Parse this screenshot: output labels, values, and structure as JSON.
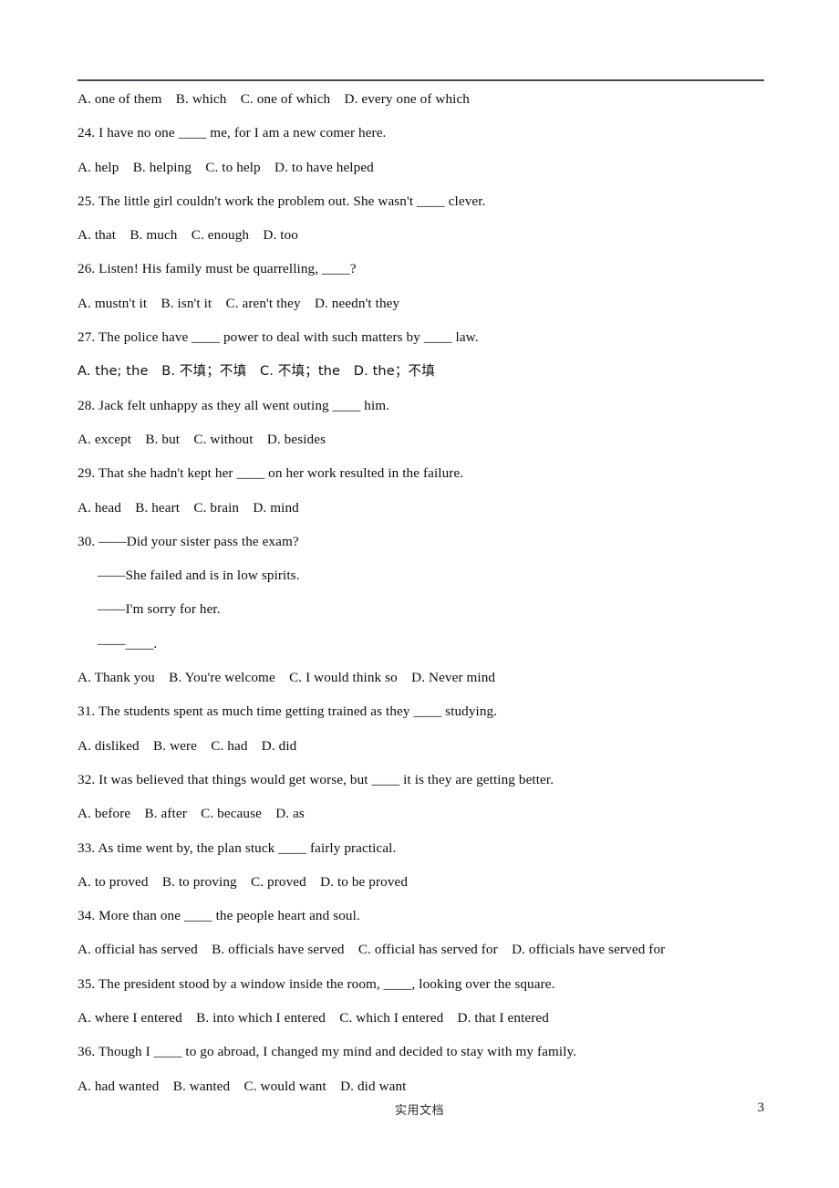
{
  "page": {
    "page_number": "3",
    "footer_label": "实用文档",
    "top_rule": true
  },
  "lines": [
    {
      "id": "q23-options",
      "type": "options",
      "text": "A. one of them B. which C. one of which D. every one of which"
    },
    {
      "id": "q24-stem",
      "type": "question",
      "text": "24. I have no one ____ me, for I am a new comer here."
    },
    {
      "id": "q24-options",
      "type": "options",
      "text": "A. help B. helping C. to help D. to have helped"
    },
    {
      "id": "q25-stem",
      "type": "question",
      "text": "25. The little girl couldn't work the problem out. She wasn't ____ clever."
    },
    {
      "id": "q25-options",
      "type": "options",
      "text": "A. that B. much C. enough D. too"
    },
    {
      "id": "q26-stem",
      "type": "question",
      "text": "26. Listen! His family must be quarrelling, ____?"
    },
    {
      "id": "q26-options",
      "type": "options",
      "text": "A. mustn't it B. isn't it C. aren't they D. needn't they"
    },
    {
      "id": "q27-stem",
      "type": "question",
      "text": "27. The police have ____ power to deal with such matters by ____ law."
    },
    {
      "id": "q27-options",
      "type": "options",
      "text": "A. the; the B. 不填；不填 C. 不填；the D. the；不填"
    },
    {
      "id": "q28-stem",
      "type": "question",
      "text": "28. Jack felt unhappy as they all went outing ____ him."
    },
    {
      "id": "q28-options",
      "type": "options",
      "text": "A. except B. but C. without D. besides"
    },
    {
      "id": "q29-stem",
      "type": "question",
      "text": "29. That she hadn't kept her ____ on her work resulted in the failure."
    },
    {
      "id": "q29-options",
      "type": "options",
      "text": "A. head B. heart C. brain D. mind"
    },
    {
      "id": "q30-stem",
      "type": "question",
      "text": "30. ——Did your sister pass the exam?"
    },
    {
      "id": "q30-reply-1",
      "type": "dialogue",
      "text": "——She failed and is in low spirits."
    },
    {
      "id": "q30-reply-2",
      "type": "dialogue",
      "text": "——I'm sorry for her."
    },
    {
      "id": "q30-reply-3",
      "type": "dialogue",
      "text": "——____."
    },
    {
      "id": "q30-options",
      "type": "options",
      "text": "A. Thank you B. You're welcome C. I would think so D. Never mind"
    },
    {
      "id": "q31-stem",
      "type": "question",
      "text": "31. The students spent as much time getting trained as they ____ studying."
    },
    {
      "id": "q31-options",
      "type": "options",
      "text": "A. disliked B. were C. had D. did"
    },
    {
      "id": "q32-stem",
      "type": "question",
      "text": "32. It was believed that things would get worse, but ____ it is they are getting better."
    },
    {
      "id": "q32-options",
      "type": "options",
      "text": "A. before B. after C. because D. as"
    },
    {
      "id": "q33-stem",
      "type": "question",
      "text": "33. As time went by, the plan stuck ____ fairly practical."
    },
    {
      "id": "q33-options",
      "type": "options",
      "text": "A. to proved B. to proving C. proved D. to be proved"
    },
    {
      "id": "q34-stem",
      "type": "question",
      "text": "34. More than one ____ the people heart and soul."
    },
    {
      "id": "q34-options",
      "type": "options",
      "text": "A. official has served B. officials have served C. official has served for D. officials have served for"
    },
    {
      "id": "q35-stem",
      "type": "question",
      "text": "35. The president stood by a window inside the room, ____, looking over the square."
    },
    {
      "id": "q35-options",
      "type": "options",
      "text": "A. where I entered B. into which I entered C. which I entered D. that I entered"
    },
    {
      "id": "q36-stem",
      "type": "question",
      "text": "36. Though I ____ to go abroad, I changed my mind and decided to stay with my family."
    },
    {
      "id": "q36-options",
      "type": "options",
      "text": "A. had wanted B. wanted C. would want D. did want"
    }
  ],
  "questions": [
    {
      "number": "24",
      "stem": "24. I have no one ____ me, for I am a new comer here.",
      "options": [
        "A. help",
        "B. helping",
        "C. to help",
        "D. to have helped"
      ]
    },
    {
      "number": "25",
      "stem": "25. The little girl couldn't work the problem out. She wasn't ____ clever.",
      "options": [
        "A. that",
        "B. much",
        "C. enough",
        "D. too"
      ]
    },
    {
      "number": "26",
      "stem": "26. Listen! His family must be quarrelling, ____?",
      "options": [
        "A. mustn't it",
        "B. isn't it",
        "C. aren't they",
        "D. needn't they"
      ]
    },
    {
      "number": "27",
      "stem": "27. The police have ____ power to deal with such matters by ____ law.",
      "options": [
        "A. the; the",
        "B. 不填；不填",
        "C. 不填；the",
        "D. the；不填"
      ]
    },
    {
      "number": "28",
      "stem": "28. Jack felt unhappy as they all went outing ____ him.",
      "options": [
        "A. except",
        "B. but",
        "C. without",
        "D. besides"
      ]
    },
    {
      "number": "29",
      "stem": "29. That she hadn't kept her ____ on her work resulted in the failure.",
      "options": [
        "A. head",
        "B. heart",
        "C. brain",
        "D. mind"
      ]
    },
    {
      "number": "30",
      "stem": "30. ——Did your sister pass the exam?",
      "dialogue": [
        "——She failed and is in low spirits.",
        "——I'm sorry for her.",
        "——____."
      ],
      "options": [
        "A. Thank you",
        "B. You're welcome",
        "C. I would think so",
        "D. Never mind"
      ]
    },
    {
      "number": "31",
      "stem": "31. The students spent as much time getting trained as they ____ studying.",
      "options": [
        "A. disliked",
        "B. were",
        "C. had",
        "D. did"
      ]
    },
    {
      "number": "32",
      "stem": "32. It was believed that things would get worse, but ____ it is they are getting better.",
      "options": [
        "A. before",
        "B. after",
        "C. because",
        "D. as"
      ]
    },
    {
      "number": "33",
      "stem": "33. As time went by, the plan stuck ____ fairly practical.",
      "options": [
        "A. to proved",
        "B. to proving",
        "C. proved",
        "D. to be proved"
      ]
    },
    {
      "number": "34",
      "stem": "34. More than one ____ the people heart and soul.",
      "options": [
        "A. official has served",
        "B. officials have served",
        "C. official has served for",
        "D. officials have served for"
      ]
    },
    {
      "number": "35",
      "stem": "35. The president stood by a window inside the room, ____, looking over the square.",
      "options": [
        "A. where I entered",
        "B. into which I entered",
        "C. which I entered",
        "D. that I entered"
      ]
    },
    {
      "number": "36",
      "stem": "36. Though I ____ to go abroad, I changed my mind and decided to stay with my family.",
      "options": [
        "A. had wanted",
        "B. wanted",
        "C. would want",
        "D. did want"
      ]
    }
  ]
}
